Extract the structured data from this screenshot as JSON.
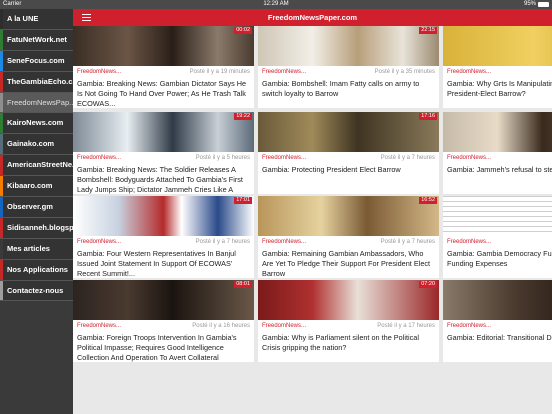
{
  "status": {
    "carrier": "Carrier",
    "time": "12:29 AM",
    "battery": "95%",
    "battery_level": 0.95
  },
  "header": {
    "title": "FreedomNewsPaper.com"
  },
  "sidebar": {
    "items": [
      {
        "label": "A la UNE",
        "color": "#2d2d2d"
      },
      {
        "label": "FatuNetWork.net",
        "color": "#2e7d32"
      },
      {
        "label": "SeneFocus.com",
        "color": "#1e88e5"
      },
      {
        "label": "TheGambiaEcho.c...",
        "color": "#c62828"
      },
      {
        "label": "FreedomNewsPap...",
        "color": "#8e8e8e"
      },
      {
        "label": "KairoNews.com",
        "color": "#2e7d32"
      },
      {
        "label": "Gainako.com",
        "color": "#546e7a"
      },
      {
        "label": "AmericanStreetNe...",
        "color": "#c62828"
      },
      {
        "label": "Kibaaro.com",
        "color": "#f57c00"
      },
      {
        "label": "Observer.gm",
        "color": "#1565c0"
      },
      {
        "label": "Sidisanneh.blogsp...",
        "color": "#c62828"
      },
      {
        "label": "Mes articles",
        "color": "#3a3a3a"
      },
      {
        "label": "Nos Applications",
        "color": "#c62828"
      },
      {
        "label": "Contactez-nous",
        "color": "#9e9e9e"
      }
    ],
    "active_index": 4
  },
  "cards": [
    {
      "badge": "00:02",
      "source": "FreedomNews...",
      "time": "Posté il y a 19 minutes",
      "headline": "Gambia: Breaking News: Gambian Dictator Says He Is Not Going To Hand Over Power; As He Trash Talk ECOWAS...",
      "img": "dark-crowd"
    },
    {
      "badge": "22:15",
      "source": "FreedomNews...",
      "time": "Posté il y a 35 minutes",
      "headline": "Gambia: Bombshell: Imam Fatty calls on army to switch loyalty to Barrow",
      "img": "white-robes"
    },
    {
      "badge": "",
      "source": "FreedomNews...",
      "time": "",
      "headline": "Gambia: Why Grts Is Manipulating Ignoring President-Elect Barrow?",
      "img": "yellow"
    },
    {
      "badge": "19:22",
      "source": "FreedomNews...",
      "time": "Posté il y a 5 heures",
      "headline": "Gambia: Breaking News: The Soldier Releases A Bombshell: Bodyguards Attached To Gambia's First Lady Jumps Ship; Dictator Jammeh Cries Like A Baby Upon...",
      "img": "street"
    },
    {
      "badge": "17:16",
      "source": "FreedomNews...",
      "time": "Posté il y a 7 heures",
      "headline": "Gambia: Protecting President Elect Barrow",
      "img": "crowd-brown"
    },
    {
      "badge": "",
      "source": "FreedomNews...",
      "time": "",
      "headline": "Gambia: Jammeh's refusal to step solution",
      "img": "portrait"
    },
    {
      "badge": "17:01",
      "source": "FreedomNews...",
      "time": "Posté il y a 7 heures",
      "headline": "Gambia: Four Western Representatives In Banjul Issued Joint Statement In Support Of ECOWAS' Recent Summit!...",
      "img": "flags"
    },
    {
      "badge": "16:52",
      "source": "FreedomNews...",
      "time": "Posté il y a 7 heures",
      "headline": "Gambia: Remaining Gambian Ambassadors, Who Are Yet To Pledge Their Support For President Elect Barrow",
      "img": "meeting"
    },
    {
      "badge": "",
      "source": "FreedomNews...",
      "time": "",
      "headline": "Gambia: Gambia Democracy Fund Campaign Funding Expenses",
      "img": "document"
    },
    {
      "badge": "08:01",
      "source": "FreedomNews...",
      "time": "Posté il y a 16 heures",
      "headline": "Gambia: Foreign Troops Intervention In Gambia's Political Impasse; Requires Good Intelligence Collection And Operation To Avert Collateral Damage...",
      "img": "speaker"
    },
    {
      "badge": "07:20",
      "source": "FreedomNews...",
      "time": "Posté il y a 17 heures",
      "headline": "Gambia: Why is Parliament silent on the Political Crisis gripping the nation?",
      "img": "parliament"
    },
    {
      "badge": "",
      "source": "FreedomNews...",
      "time": "",
      "headline": "Gambia: Editorial: Transitional Dea Cabinet?",
      "img": "man-glasses"
    }
  ]
}
